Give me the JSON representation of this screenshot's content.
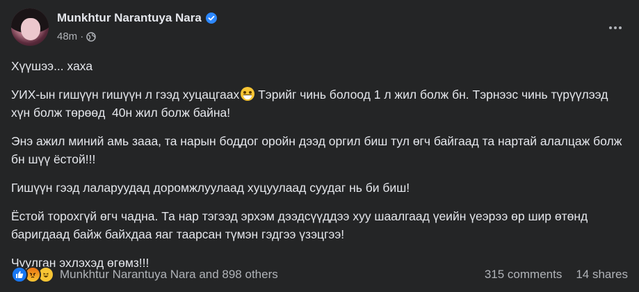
{
  "header": {
    "author": "Munkhtur Narantuya Nara",
    "time": "48m",
    "separator": "·"
  },
  "post": {
    "paragraphs": [
      "Хүүшээ... хаха",
      "УИХ-ын гишүүн гишүүн л гээд хуцацгаах",
      " Тэрийг чинь болоод 1 л жил болж бн. Тэрнээс чинь түрүүлээд хүн болж төрөөд  40н жил болж байна!",
      "Энэ ажил миний амь зааа, та нарын боддог оройн дээд оргил биш тул өгч байгаад та нартай алалцаж болж бн шүү ёстой!!!",
      "Гишүүн гээд лаларуудад доромжлуулаад хуцуулаад суудаг нь би биш!",
      "Ёстой торохгүй өгч чадна. Та нар тэгээд эрхэм дээдсүүддээ хуу шаалгаад үеийн үеэрээ өр шир өтөнд баригдаад байж байхдаа яаг таарсан түмэн гэдгээ үзэцгээ!",
      "Чуулган эхлэхэд өгөмз!!!"
    ]
  },
  "footer": {
    "reaction_names": "Munkhtur Narantuya Nara and 898 others",
    "comments": "315 comments",
    "shares": "14 shares"
  },
  "icons": [
    "verified-icon",
    "globe-icon",
    "more-icon",
    "grinning-emoji-icon",
    "like-icon",
    "angry-icon",
    "haha-icon"
  ],
  "colors": {
    "background": "#242526",
    "primary_text": "#e4e6eb",
    "secondary_text": "#b0b3b8",
    "verified": "#2d88ff",
    "like": "#1877f2"
  }
}
